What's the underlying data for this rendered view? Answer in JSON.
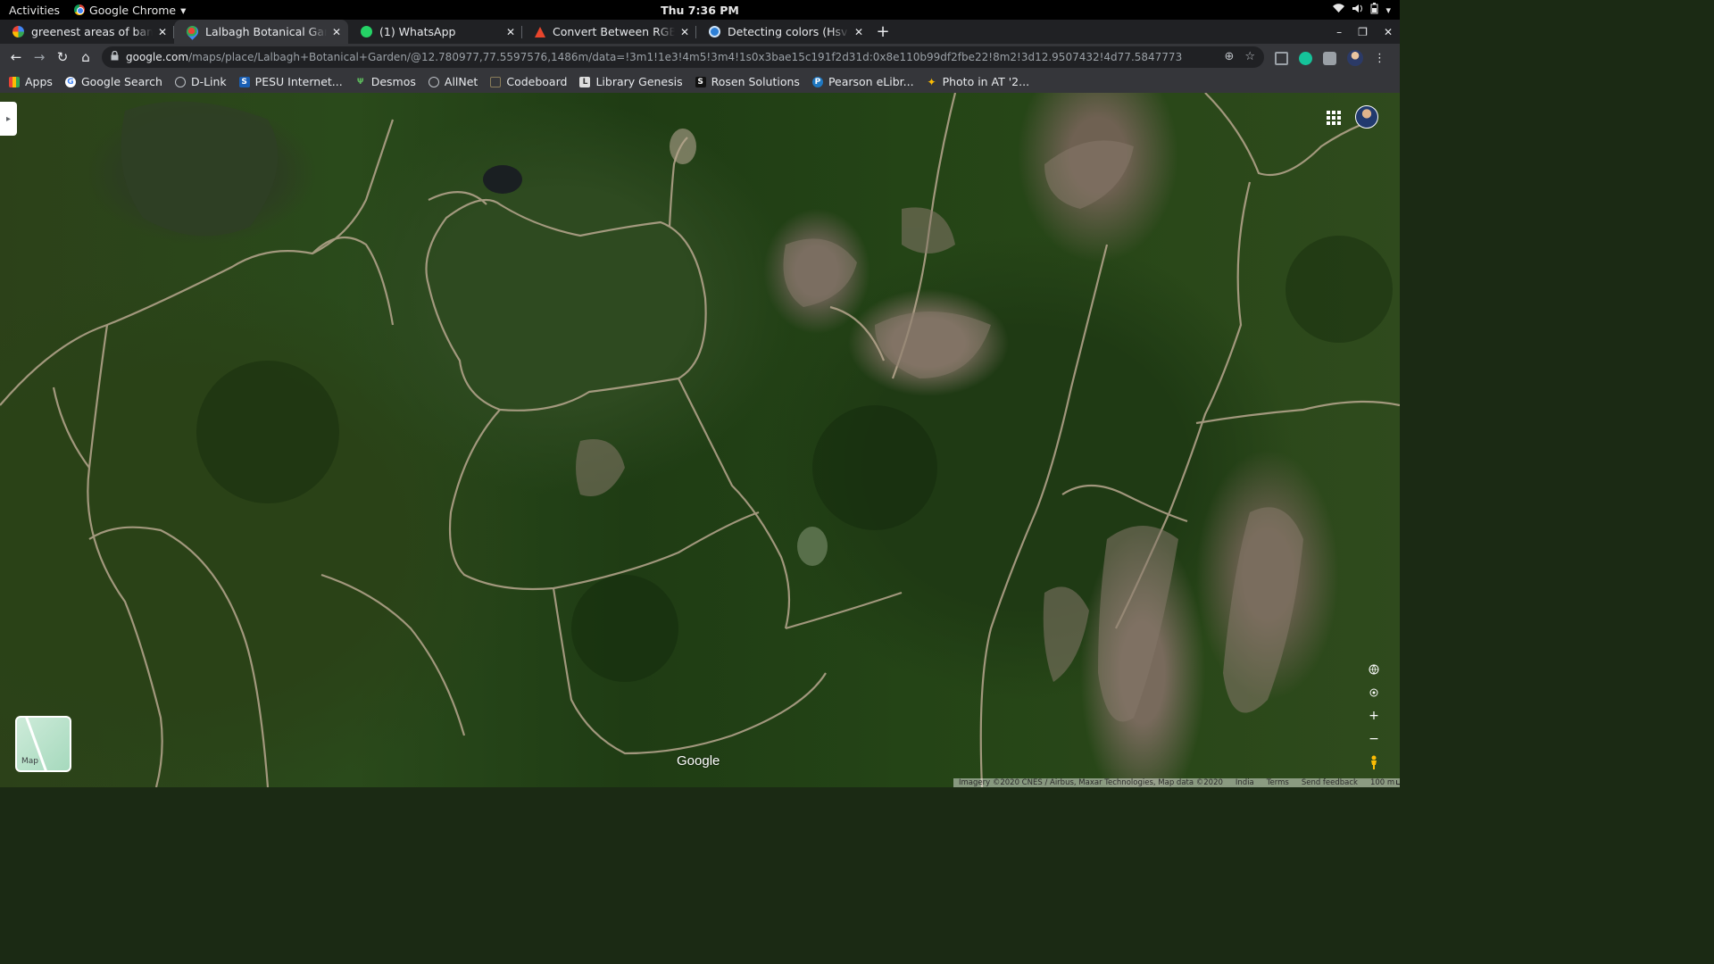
{
  "system_bar": {
    "activities": "Activities",
    "app_name": "Google Chrome",
    "app_menu_arrow": "▾",
    "clock": "Thu  7:36 PM",
    "tray_icons": [
      "wifi-icon",
      "volume-icon",
      "battery-icon",
      "power-menu-icon"
    ]
  },
  "tabs": [
    {
      "title": "greenest areas of bangalore",
      "favicon": "google-icon",
      "favicon_color": "#ffffff",
      "active": false
    },
    {
      "title": "Lalbagh Botanical Garden",
      "favicon": "google-maps-icon",
      "favicon_color": "#34a853",
      "active": true
    },
    {
      "title": "(1) WhatsApp",
      "favicon": "whatsapp-icon",
      "favicon_color": "#25d366",
      "active": false
    },
    {
      "title": "Convert Between RGB and HSV",
      "favicon": "red-triangle-icon",
      "favicon_color": "#e8452c",
      "active": false
    },
    {
      "title": "Detecting colors (Hsv Color Space)",
      "favicon": "wordpress-icon",
      "favicon_color": "#2d7fd6",
      "active": false
    }
  ],
  "tab_close_glyph": "✕",
  "new_tab_glyph": "+",
  "window_controls": {
    "minimize": "–",
    "restore": "❐",
    "close": "✕"
  },
  "toolbar": {
    "back": "←",
    "forward": "→",
    "reload": "↻",
    "home": "⌂",
    "url_host": "google.com",
    "url_path": "/maps/place/Lalbagh+Botanical+Garden/@12.780977,77.5597576,1486m/data=!3m1!1e3!4m5!3m4!1s0x3bae15c191f2d31d:0x8e110b99df2fbe22!8m2!3d12.9507432!4d77.5847773",
    "lock_glyph": "🔒",
    "install_glyph": "⊕",
    "star_glyph": "☆"
  },
  "bookmarks": [
    {
      "label": "Apps",
      "icon": "apps-grid-icon",
      "color": "#ea4335",
      "glyph": "⁞"
    },
    {
      "label": "Google Search",
      "icon": "google-icon",
      "color": "#ffffff",
      "glyph": "G"
    },
    {
      "label": "D-Link",
      "icon": "globe-icon",
      "color": "#bdc1c6",
      "glyph": "◎"
    },
    {
      "label": "PESU Internet...",
      "icon": "pesu-icon",
      "color": "#1a5fb4",
      "glyph": "S"
    },
    {
      "label": "Desmos",
      "icon": "desmos-icon",
      "color": "#3a8f3a",
      "glyph": "Ψ"
    },
    {
      "label": "AllNet",
      "icon": "globe-icon",
      "color": "#bdc1c6",
      "glyph": "◎"
    },
    {
      "label": "Codeboard",
      "icon": "codeboard-icon",
      "color": "#8a7d5a",
      "glyph": "▭"
    },
    {
      "label": "Library Genesis",
      "icon": "library-genesis-icon",
      "color": "#dddddd",
      "glyph": "L"
    },
    {
      "label": "Rosen Solutions",
      "icon": "rosen-icon",
      "color": "#111111",
      "glyph": "S"
    },
    {
      "label": "Pearson eLibr...",
      "icon": "pearson-icon",
      "color": "#1f78c1",
      "glyph": "P"
    },
    {
      "label": "Photo in AT '2...",
      "icon": "google-photos-icon",
      "color": "#fbbc04",
      "glyph": "✦"
    }
  ],
  "map": {
    "view": "Satellite",
    "layer_toggle_label": "Map",
    "watermark": "Google",
    "controls": {
      "globe": "🌐",
      "compass": "●",
      "zoom_in": "+",
      "zoom_out": "−",
      "pegman": "🚶"
    },
    "attribution": {
      "imagery": "Imagery ©2020 CNES / Airbus, Maxar Technologies, Map data ©2020",
      "region": "India",
      "terms": "Terms",
      "feedback": "Send feedback",
      "scale": "100 m"
    }
  },
  "colors": {
    "chrome_dark": "#202124",
    "chrome_toolbar": "#35363a",
    "map_green": "#2a4a1b",
    "road_tan": "#b8a78f"
  }
}
